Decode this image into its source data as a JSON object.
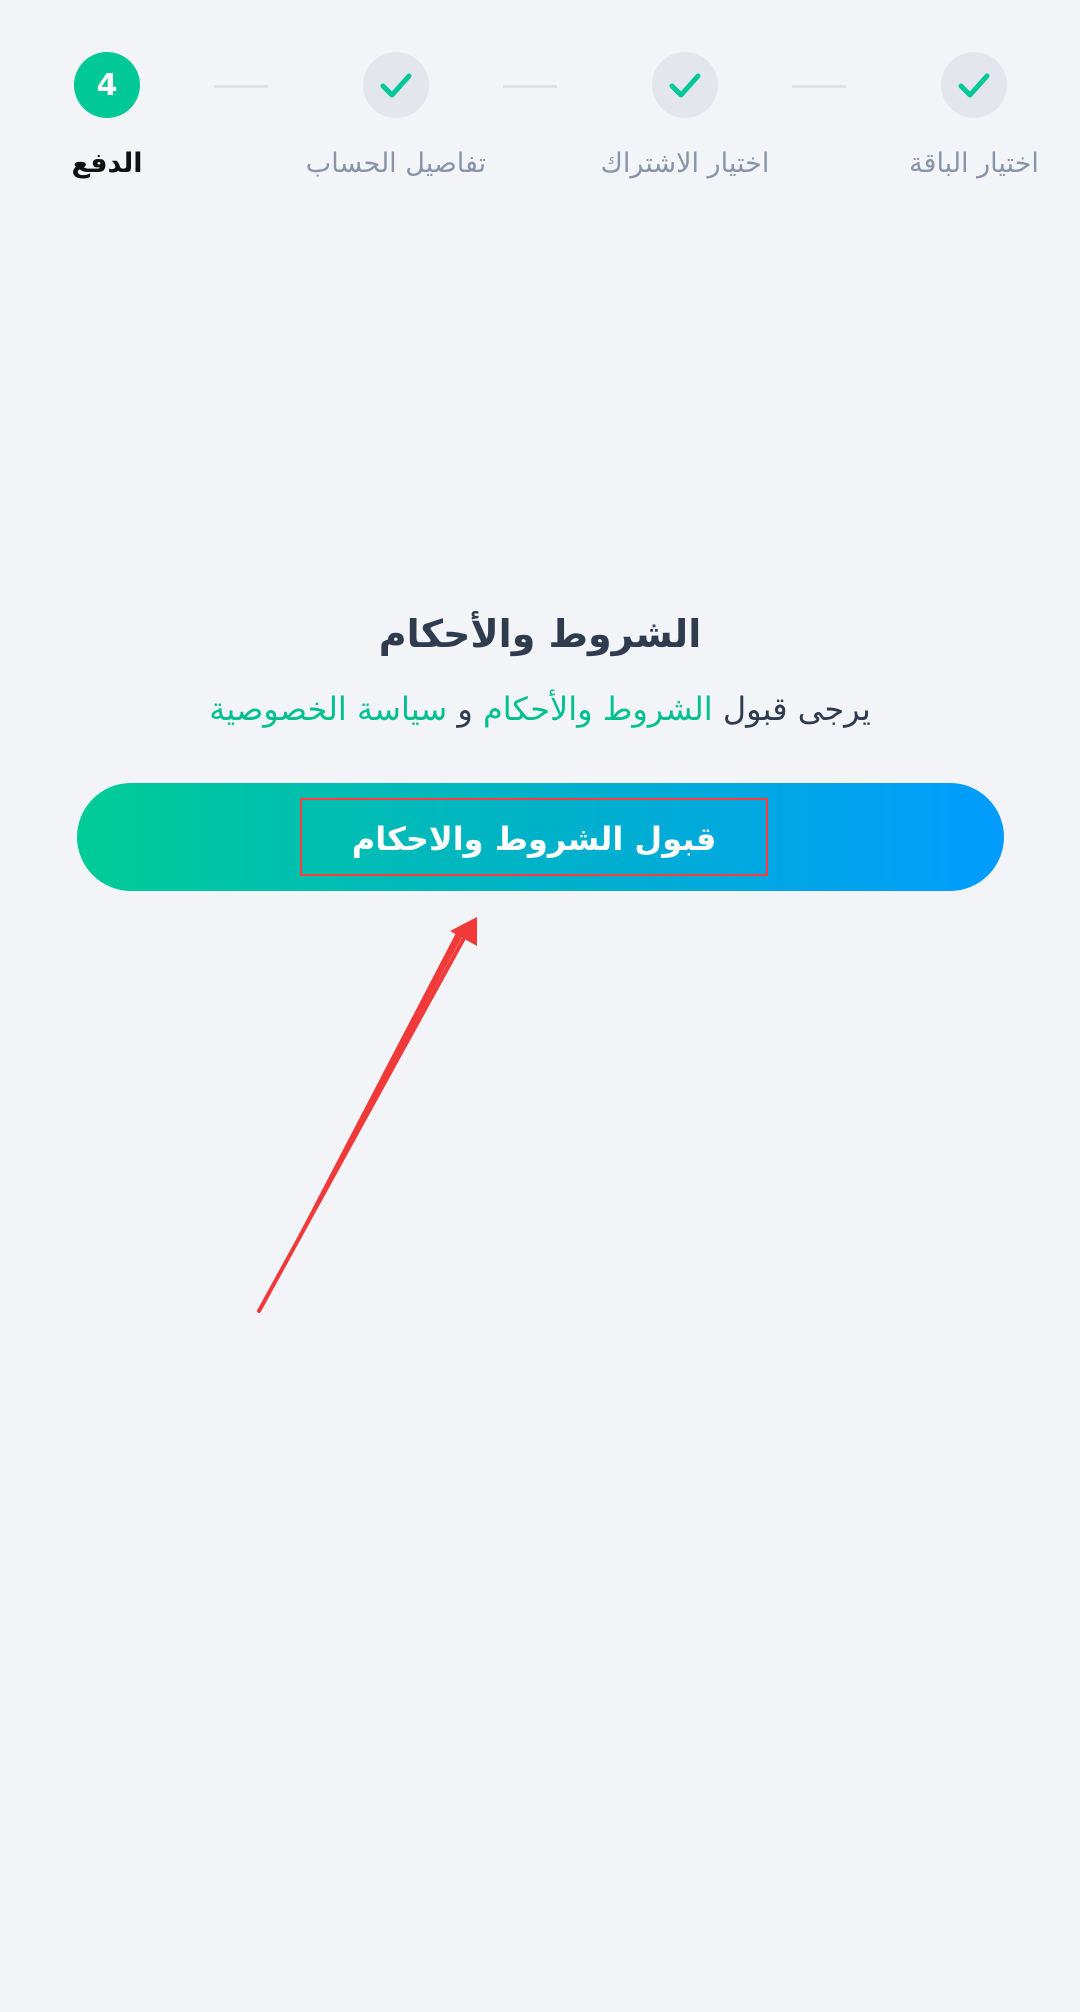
{
  "stepper": {
    "steps": [
      {
        "label": "اختيار الباقة",
        "status": "done"
      },
      {
        "label": "اختيار الاشتراك",
        "status": "done"
      },
      {
        "label": "تفاصيل الحساب",
        "status": "done"
      },
      {
        "label": "الدفع",
        "status": "active",
        "number": "4"
      }
    ]
  },
  "terms": {
    "title": "الشروط والأحكام",
    "prefix": "يرجى قبول",
    "terms_link": "الشروط والأحكام",
    "conjunction": "و",
    "privacy_link": "سياسة الخصوصية"
  },
  "accept_button": {
    "label": "قبول الشروط والاحكام"
  },
  "colors": {
    "accent": "#00c896",
    "gradient_start": "#00cc96",
    "gradient_end": "#009cff",
    "annotation": "#f03a3a"
  }
}
